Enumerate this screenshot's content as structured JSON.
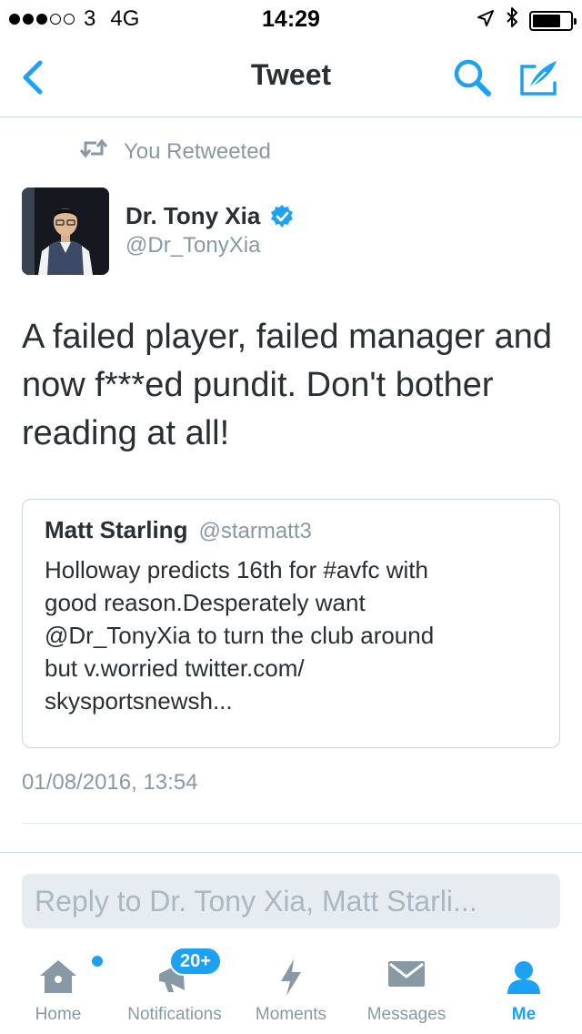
{
  "status_bar": {
    "carrier": "3",
    "network": "4G",
    "time": "14:29",
    "signal_bars_filled": 3,
    "signal_bars_total": 5,
    "battery_level": 0.75
  },
  "nav": {
    "title": "Tweet",
    "back_icon": "chevron-left-icon",
    "search_icon": "search-icon",
    "compose_icon": "compose-tweet-icon"
  },
  "tweet": {
    "retweet_label": "You Retweeted",
    "author_name": "Dr. Tony Xia",
    "author_handle": "@Dr_TonyXia",
    "verified": true,
    "text": "A failed player, failed manager and\nnow f***ed pundit. Don't bother\nreading at all!",
    "quoted": {
      "author_name": "Matt Starling",
      "author_handle": "@starmatt3",
      "text": "Holloway predicts 16th for #avfc with\ngood reason.Desperately want\n@Dr_TonyXia to turn the club around\nbut v.worried twitter.com/\nskysportsnewsh..."
    },
    "timestamp": "01/08/2016, 13:54"
  },
  "reply": {
    "placeholder": "Reply to Dr. Tony Xia, Matt Starli..."
  },
  "tabs": [
    {
      "label": "Home",
      "icon": "home-icon",
      "has_dot": true
    },
    {
      "label": "Notifications",
      "icon": "notifications-icon",
      "badge": "20+"
    },
    {
      "label": "Moments",
      "icon": "lightning-icon"
    },
    {
      "label": "Messages",
      "icon": "envelope-icon"
    },
    {
      "label": "Me",
      "icon": "person-icon",
      "active": true
    }
  ],
  "colors": {
    "accent": "#1da1f2",
    "text": "#292f33",
    "secondary": "#8899a6",
    "border": "#ccd6dd",
    "input_bg": "#e6ecf0"
  }
}
